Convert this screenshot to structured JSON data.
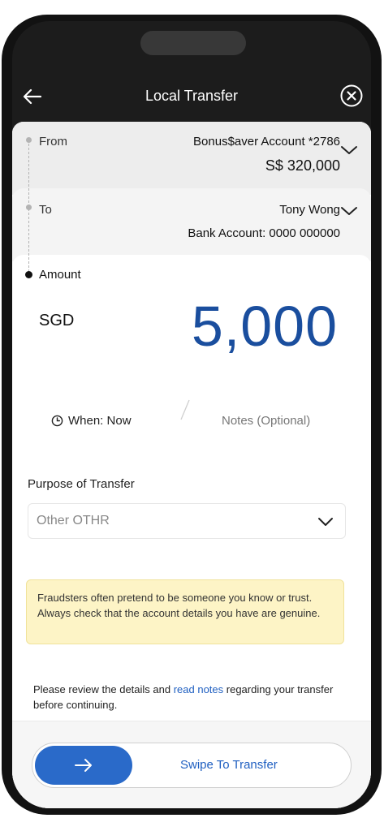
{
  "header": {
    "title": "Local Transfer"
  },
  "from": {
    "label": "From",
    "account_name": "Bonus$aver Account *2786",
    "balance": "S$ 320,000"
  },
  "to": {
    "label": "To",
    "name": "Tony Wong",
    "account": "Bank Account: 0000 000000"
  },
  "amount": {
    "label": "Amount",
    "currency": "SGD",
    "value": "5,000"
  },
  "options": {
    "when": "When: Now",
    "notes": "Notes (Optional)"
  },
  "purpose": {
    "label": "Purpose of Transfer",
    "value": "Other OTHR"
  },
  "warning": {
    "text": "Fraudsters often pretend to be someone you know or trust. Always check that the account details you have are genuine."
  },
  "review": {
    "before": "Please review the details and ",
    "link": "read notes",
    "after": " regarding your transfer before continuing."
  },
  "swipe": {
    "label": "Swipe To Transfer"
  },
  "colors": {
    "accent": "#2a6ac9",
    "amount": "#1a4e9e",
    "warning_bg": "#fdf4c6"
  }
}
